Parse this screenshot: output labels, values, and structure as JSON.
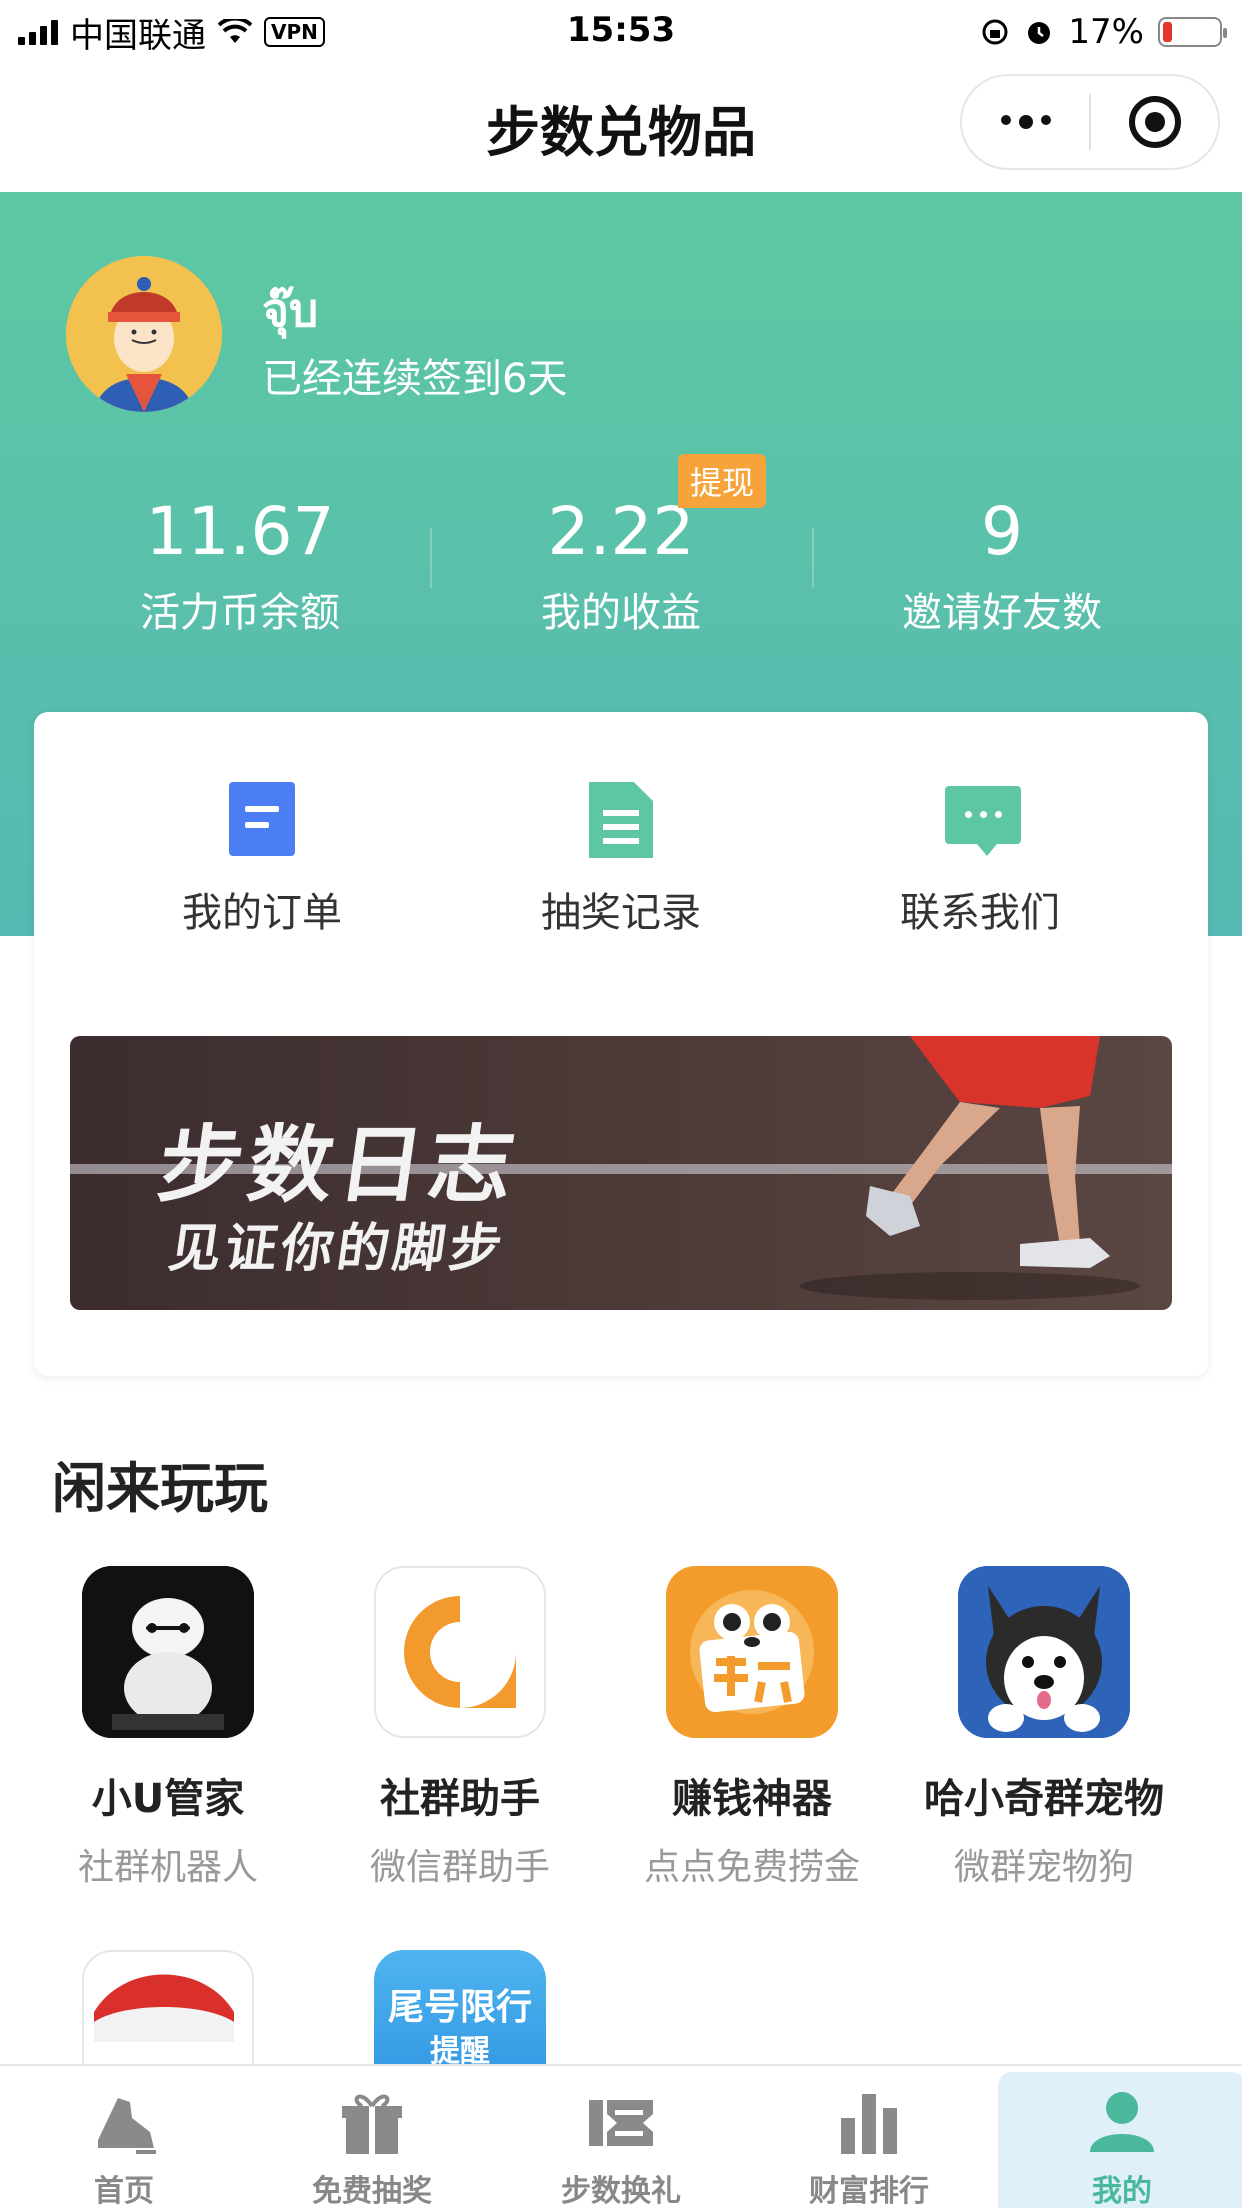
{
  "status_bar": {
    "carrier": "中国联通",
    "vpn": "VPN",
    "time": "15:53",
    "battery": "17%",
    "battery_level": 0.17
  },
  "nav": {
    "title": "步数兑物品"
  },
  "profile": {
    "name": "จุ๊บ",
    "checkin_text": "已经连续签到6天"
  },
  "stats": [
    {
      "value": "11.67",
      "label": "活力币余额"
    },
    {
      "value": "2.22",
      "label": "我的收益"
    },
    {
      "value": "9",
      "label": "邀请好友数"
    }
  ],
  "withdraw_badge": "提现",
  "menu": [
    {
      "label": "我的订单",
      "icon": "order-icon"
    },
    {
      "label": "抽奖记录",
      "icon": "lottery-record-icon"
    },
    {
      "label": "联系我们",
      "icon": "chat-icon"
    }
  ],
  "banner": {
    "title": "步数日志",
    "subtitle": "见证你的脚步"
  },
  "section": {
    "title": "闲来玩玩"
  },
  "games": [
    {
      "name": "小U管家",
      "desc": "社群机器人"
    },
    {
      "name": "社群助手",
      "desc": "微信群助手"
    },
    {
      "name": "赚钱神器",
      "desc": "点点免费捞金"
    },
    {
      "name": "哈小奇群宠物",
      "desc": "微群宠物狗"
    }
  ],
  "partial_games": [
    {
      "label": ""
    },
    {
      "label": "尾号限行",
      "sub": "提醒"
    }
  ],
  "tabs": [
    {
      "label": "首页",
      "icon": "shoe-icon"
    },
    {
      "label": "免费抽奖",
      "icon": "gift-icon"
    },
    {
      "label": "步数换礼",
      "icon": "exchange-icon"
    },
    {
      "label": "财富排行",
      "icon": "bar-chart-icon"
    },
    {
      "label": "我的",
      "icon": "user-icon",
      "active": true
    }
  ],
  "colors": {
    "accent": "#5ec8a2",
    "hero_end": "#56b9b3",
    "badge": "#f5a33a",
    "active_tab_bg": "#dff0fb",
    "active_tab_text": "#4ab89a"
  }
}
